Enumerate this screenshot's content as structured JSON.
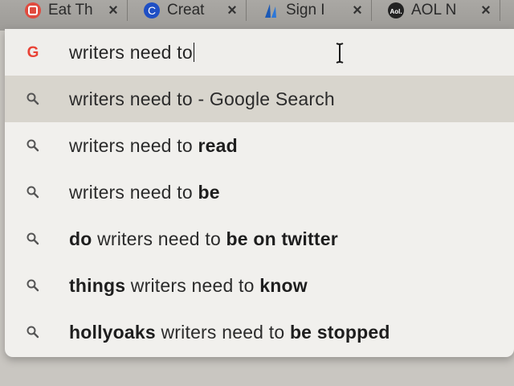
{
  "tabs": [
    {
      "title": "Eat Th",
      "icon": "red-blogger-icon",
      "close": "×"
    },
    {
      "title": "Creat",
      "icon": "blue-c-icon",
      "close": "×"
    },
    {
      "title": "Sign I",
      "icon": "blue-sail-icon",
      "close": "×"
    },
    {
      "title": "AOL N",
      "icon": "aol-icon",
      "close": "×"
    }
  ],
  "tab_icon_text": {
    "c": "C",
    "aol": "Aol."
  },
  "omnibox": {
    "value": "writers need to",
    "icon": "google-g-icon",
    "g": "G"
  },
  "suggestions": [
    {
      "parts": [
        {
          "t": "writers need to - Google Search",
          "b": false
        }
      ],
      "selected": true
    },
    {
      "parts": [
        {
          "t": "writers need to ",
          "b": false
        },
        {
          "t": "read",
          "b": true
        }
      ],
      "selected": false
    },
    {
      "parts": [
        {
          "t": "writers need to ",
          "b": false
        },
        {
          "t": "be",
          "b": true
        }
      ],
      "selected": false
    },
    {
      "parts": [
        {
          "t": "do",
          "b": true
        },
        {
          "t": " writers need to ",
          "b": false
        },
        {
          "t": "be on twitter",
          "b": true
        }
      ],
      "selected": false
    },
    {
      "parts": [
        {
          "t": "things",
          "b": true
        },
        {
          "t": " writers need to ",
          "b": false
        },
        {
          "t": "know",
          "b": true
        }
      ],
      "selected": false
    },
    {
      "parts": [
        {
          "t": "hollyoaks",
          "b": true
        },
        {
          "t": " writers need to ",
          "b": false
        },
        {
          "t": "be stopped",
          "b": true
        }
      ],
      "selected": false
    }
  ],
  "colors": {
    "selected_row": "#d8d5cd",
    "dropdown_bg": "#f1f0ed",
    "google_red": "#e94235",
    "google_blue": "#3b6fd4"
  }
}
